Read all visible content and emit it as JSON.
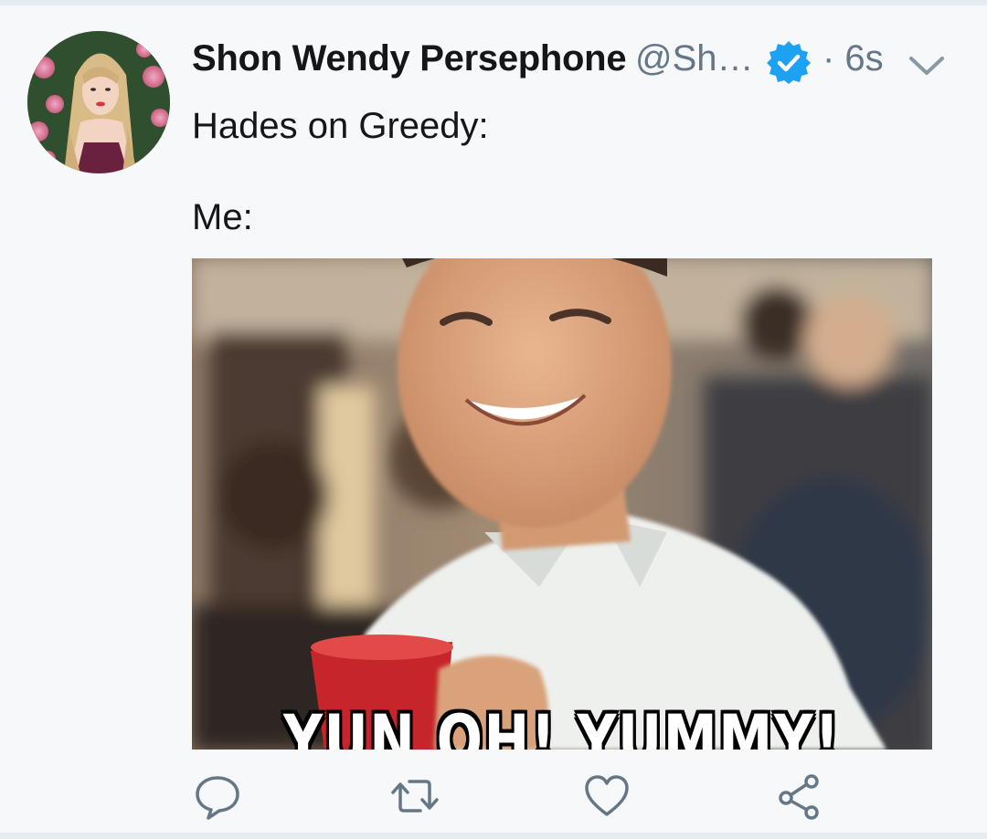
{
  "tweet": {
    "display_name": "Shon Wendy Persephone",
    "handle": "@Sh…",
    "time": "· 6s",
    "text_line1": "Hades on Greedy:",
    "text_line2": "Me:",
    "media_caption": "YUN OH! YUMMY!"
  },
  "icons": {
    "verified": "verified-badge-icon",
    "caret": "chevron-down-icon",
    "reply": "reply-icon",
    "retweet": "retweet-icon",
    "like": "heart-icon",
    "share": "share-icon"
  },
  "colors": {
    "verified_blue": "#1da1f2",
    "text_primary": "#14171a",
    "text_secondary": "#657786",
    "icon_gray": "#657786",
    "background": "#f7f8f9"
  }
}
